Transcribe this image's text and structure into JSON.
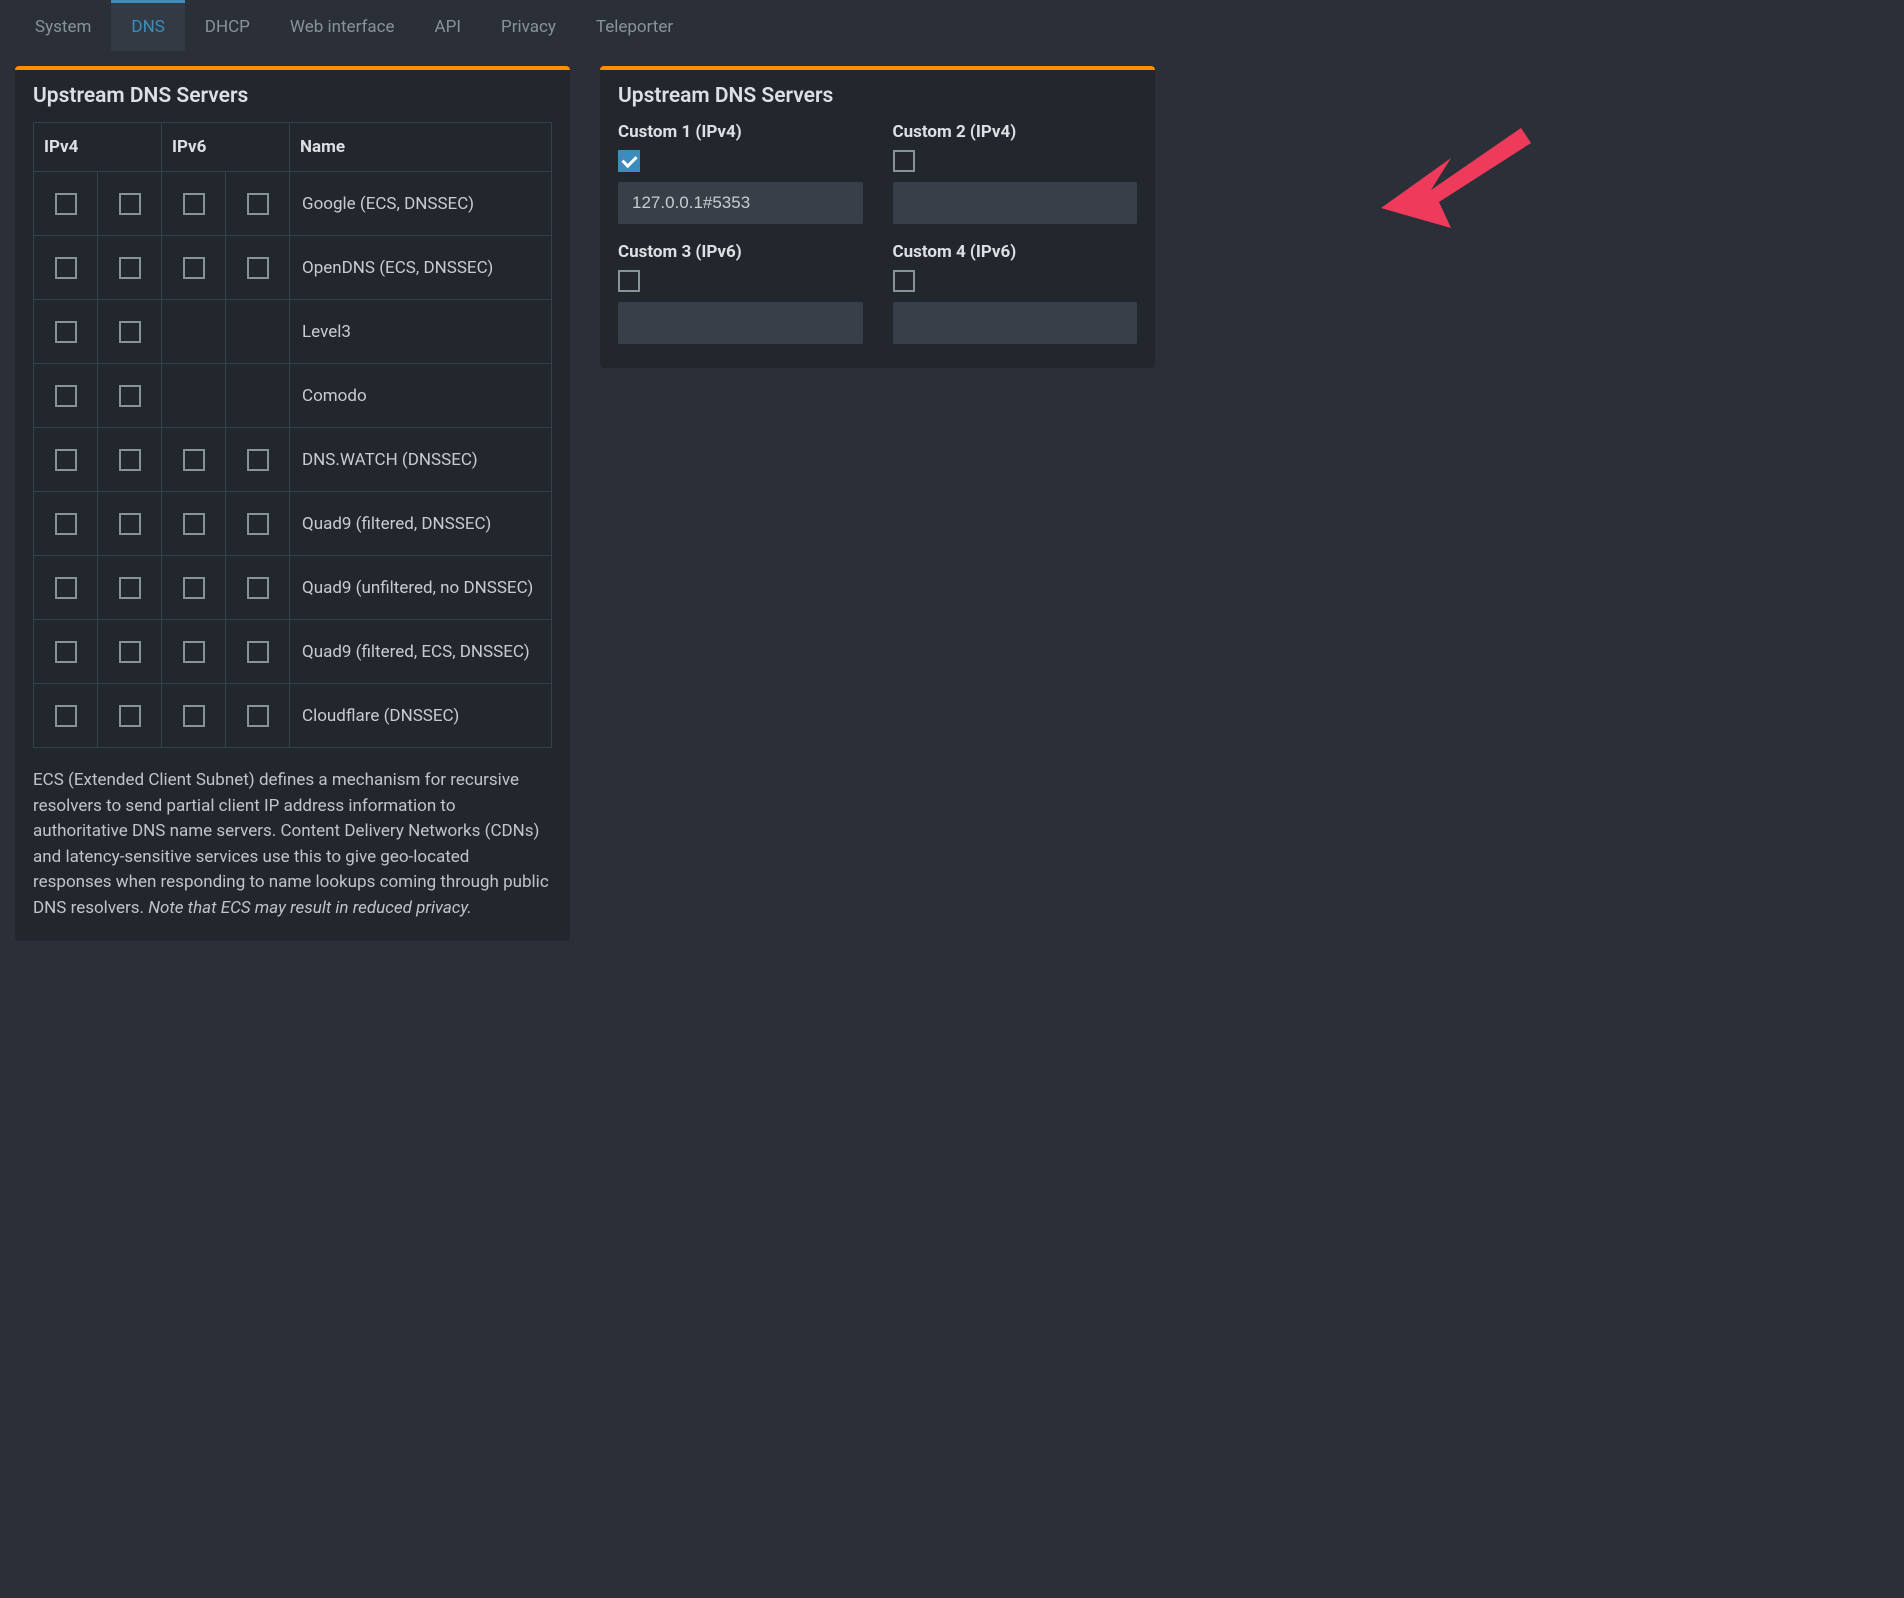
{
  "tabs": [
    {
      "label": "System",
      "active": false
    },
    {
      "label": "DNS",
      "active": true
    },
    {
      "label": "DHCP",
      "active": false
    },
    {
      "label": "Web interface",
      "active": false
    },
    {
      "label": "API",
      "active": false
    },
    {
      "label": "Privacy",
      "active": false
    },
    {
      "label": "Teleporter",
      "active": false
    }
  ],
  "left_panel": {
    "title": "Upstream DNS Servers",
    "headers": {
      "ipv4": "IPv4",
      "ipv6": "IPv6",
      "name": "Name"
    },
    "providers": [
      {
        "name": "Google (ECS, DNSSEC)",
        "ipv4_count": 2,
        "ipv6_count": 2
      },
      {
        "name": "OpenDNS (ECS, DNSSEC)",
        "ipv4_count": 2,
        "ipv6_count": 2
      },
      {
        "name": "Level3",
        "ipv4_count": 2,
        "ipv6_count": 0
      },
      {
        "name": "Comodo",
        "ipv4_count": 2,
        "ipv6_count": 0
      },
      {
        "name": "DNS.WATCH (DNSSEC)",
        "ipv4_count": 2,
        "ipv6_count": 2
      },
      {
        "name": "Quad9 (filtered, DNSSEC)",
        "ipv4_count": 2,
        "ipv6_count": 2
      },
      {
        "name": "Quad9 (unfiltered, no DNSSEC)",
        "ipv4_count": 2,
        "ipv6_count": 2
      },
      {
        "name": "Quad9 (filtered, ECS, DNSSEC)",
        "ipv4_count": 2,
        "ipv6_count": 2
      },
      {
        "name": "Cloudflare (DNSSEC)",
        "ipv4_count": 2,
        "ipv6_count": 2
      }
    ],
    "footnote_main": "ECS (Extended Client Subnet) defines a mechanism for recursive resolvers to send partial client IP address information to authoritative DNS name servers. Content Delivery Networks (CDNs) and latency-sensitive services use this to give geo-located responses when responding to name lookups coming through public DNS resolvers. ",
    "footnote_em": "Note that ECS may result in reduced privacy."
  },
  "right_panel": {
    "title": "Upstream DNS Servers",
    "custom": [
      {
        "label": "Custom 1 (IPv4)",
        "checked": true,
        "value": "127.0.0.1#5353"
      },
      {
        "label": "Custom 2 (IPv4)",
        "checked": false,
        "value": ""
      },
      {
        "label": "Custom 3 (IPv6)",
        "checked": false,
        "value": ""
      },
      {
        "label": "Custom 4 (IPv6)",
        "checked": false,
        "value": ""
      }
    ]
  }
}
